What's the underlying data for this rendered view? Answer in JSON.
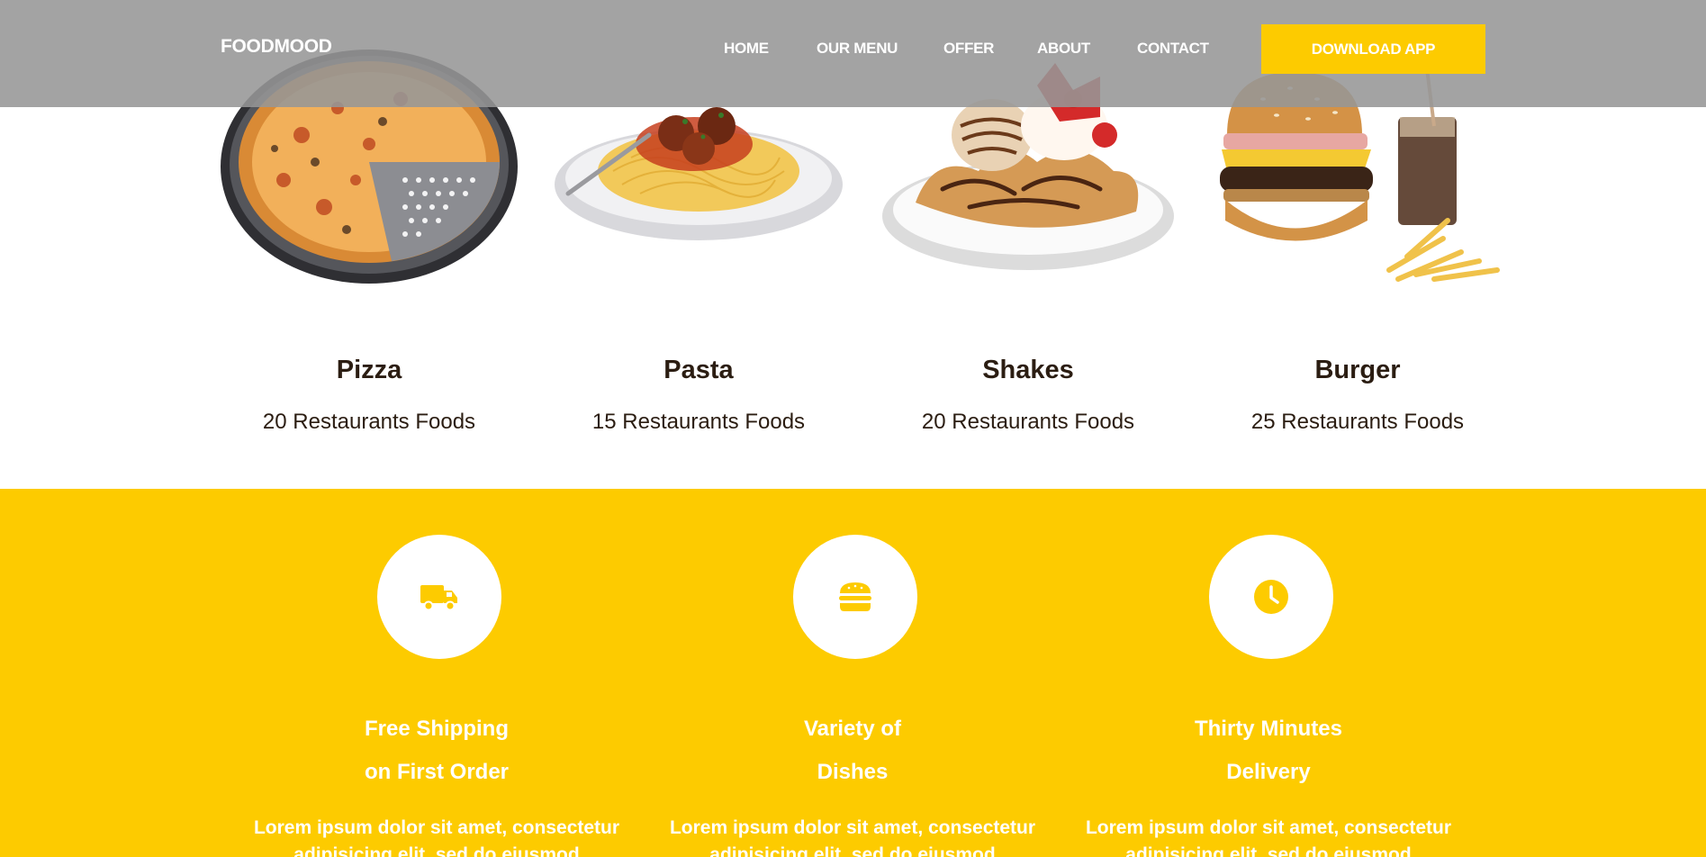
{
  "nav": {
    "brand": "FOODMOOD",
    "links": [
      "HOME",
      "OUR MENU",
      "OFFER",
      "ABOUT",
      "CONTACT"
    ],
    "download_label": "DOWNLOAD APP"
  },
  "foods": [
    {
      "name": "Pizza",
      "count": "20 Restaurants Foods",
      "icon": "pizza-image"
    },
    {
      "name": "Pasta",
      "count": "15 Restaurants Foods",
      "icon": "pasta-image"
    },
    {
      "name": "Shakes",
      "count": "20 Restaurants Foods",
      "icon": "shakes-image"
    },
    {
      "name": "Burger",
      "count": "25 Restaurants Foods",
      "icon": "burger-image"
    }
  ],
  "features": [
    {
      "title_line1": "Free Shipping",
      "title_line2": "on First Order",
      "text": "Lorem ipsum dolor sit amet, consectetur adipisicing elit, sed do eiusmod",
      "icon": "truck-icon"
    },
    {
      "title_line1": "Variety of",
      "title_line2": "Dishes",
      "text": "Lorem ipsum dolor sit amet, consectetur adipisicing elit, sed do eiusmod",
      "icon": "burger-icon"
    },
    {
      "title_line1": "Thirty Minutes",
      "title_line2": "Delivery",
      "text": "Lorem ipsum dolor sit amet, consectetur adipisicing elit, sed do eiusmod",
      "icon": "clock-icon"
    }
  ],
  "colors": {
    "accent": "#fdcb00",
    "navbar": "#969696",
    "text_dark": "#2b1d12"
  }
}
